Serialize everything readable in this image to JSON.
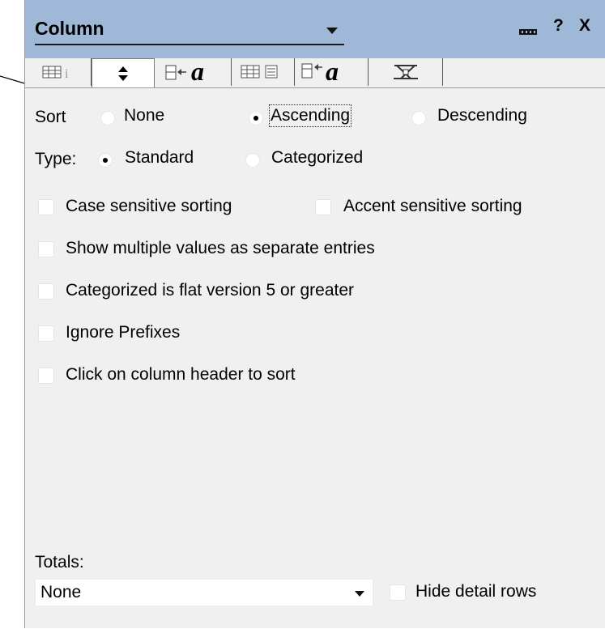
{
  "window": {
    "title": "Column",
    "help_label": "?",
    "close_label": "X"
  },
  "tabs": [
    {
      "icon": "column-info-icon"
    },
    {
      "icon": "sort-icon",
      "active": true
    },
    {
      "icon": "font-icon",
      "glyph": "a"
    },
    {
      "icon": "number-format-icon"
    },
    {
      "icon": "title-font-icon",
      "glyph": "a"
    },
    {
      "icon": "advanced-icon"
    }
  ],
  "sort": {
    "label": "Sort",
    "options": [
      "None",
      "Ascending",
      "Descending"
    ],
    "selected": "Ascending"
  },
  "type": {
    "label": "Type:",
    "options": [
      "Standard",
      "Categorized"
    ],
    "selected": "Standard"
  },
  "checkboxes": {
    "case_sensitive": "Case sensitive sorting",
    "accent_sensitive": "Accent sensitive sorting",
    "multiple_values": "Show multiple values as separate entries",
    "categorized_flat": "Categorized is flat version 5 or greater",
    "ignore_prefixes": "Ignore Prefixes",
    "click_header": "Click on column header to sort"
  },
  "totals": {
    "label": "Totals:",
    "value": "None",
    "hide_detail_label": "Hide detail rows"
  }
}
